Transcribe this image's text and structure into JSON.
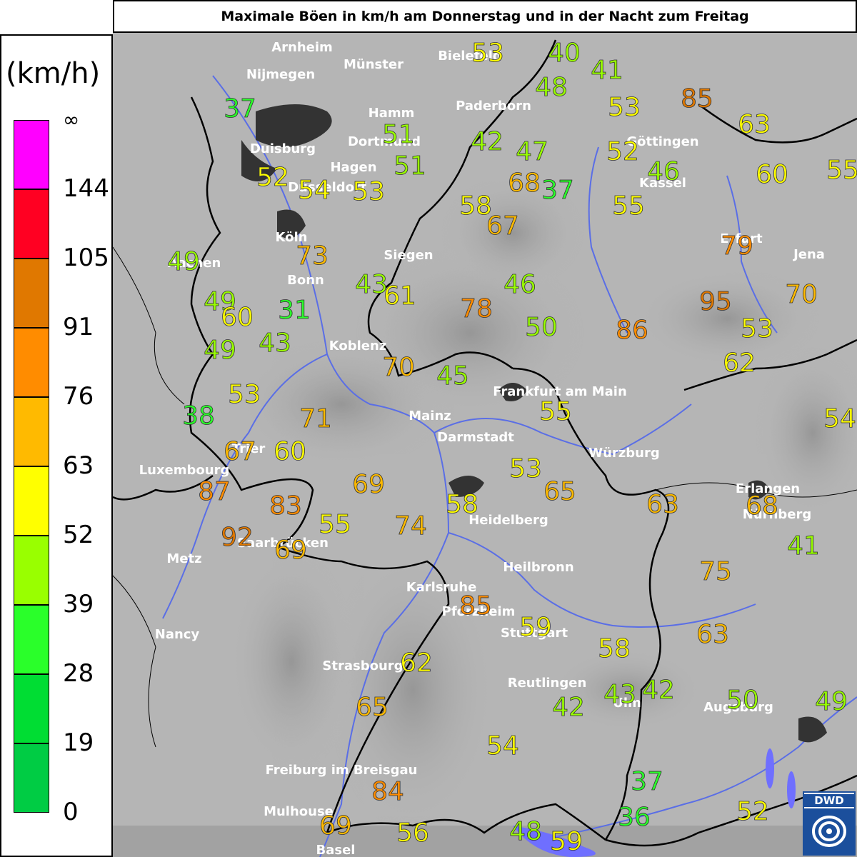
{
  "title": "Maximale Böen in km/h am Donnerstag und in der Nacht zum Freitag",
  "legend": {
    "unit": "(km/h)",
    "ticks": [
      "∞",
      "144",
      "105",
      "91",
      "76",
      "63",
      "52",
      "39",
      "28",
      "19",
      "0"
    ],
    "colors": [
      "#ff00ff",
      "#ff0022",
      "#e07800",
      "#ff8c00",
      "#ffba00",
      "#ffff00",
      "#99ff00",
      "#2aff2a",
      "#00dd33",
      "#00cc44"
    ]
  },
  "logo_text": "DWD",
  "cities": [
    {
      "name": "Arnheim"
    },
    {
      "name": "Nijmegen"
    },
    {
      "name": "Münster"
    },
    {
      "name": "Bielefeld"
    },
    {
      "name": "Hamm"
    },
    {
      "name": "Paderborn"
    },
    {
      "name": "Duisburg"
    },
    {
      "name": "Dortmund"
    },
    {
      "name": "Hagen"
    },
    {
      "name": "Göttingen"
    },
    {
      "name": "Düsseldorf"
    },
    {
      "name": "Kassel"
    },
    {
      "name": "Köln"
    },
    {
      "name": "Erfurt"
    },
    {
      "name": "Siegen"
    },
    {
      "name": "Aachen"
    },
    {
      "name": "Jena"
    },
    {
      "name": "Bonn"
    },
    {
      "name": "Koblenz"
    },
    {
      "name": "Frankfurt am Main"
    },
    {
      "name": "Mainz"
    },
    {
      "name": "Darmstadt"
    },
    {
      "name": "Trier"
    },
    {
      "name": "Würzburg"
    },
    {
      "name": "Luxembourg"
    },
    {
      "name": "Erlangen"
    },
    {
      "name": "Nürnberg"
    },
    {
      "name": "Heidelberg"
    },
    {
      "name": "Saarbrücken"
    },
    {
      "name": "Metz"
    },
    {
      "name": "Heilbronn"
    },
    {
      "name": "Karlsruhe"
    },
    {
      "name": "Pforzheim"
    },
    {
      "name": "Stuttgart"
    },
    {
      "name": "Nancy"
    },
    {
      "name": "Strasbourg"
    },
    {
      "name": "Reutlingen"
    },
    {
      "name": "Ulm"
    },
    {
      "name": "Augsburg"
    },
    {
      "name": "Freiburg im Breisgau"
    },
    {
      "name": "Mulhouse"
    },
    {
      "name": "Basel"
    }
  ],
  "gust_values": [
    {
      "value": "53",
      "color": "#ffff00"
    },
    {
      "value": "40",
      "color": "#99ff00"
    },
    {
      "value": "41",
      "color": "#99ff00"
    },
    {
      "value": "48",
      "color": "#99ff00"
    },
    {
      "value": "85",
      "color": "#e07800"
    },
    {
      "value": "37",
      "color": "#2aff2a"
    },
    {
      "value": "53",
      "color": "#ffff00"
    },
    {
      "value": "63",
      "color": "#ffff00"
    },
    {
      "value": "51",
      "color": "#99ff00"
    },
    {
      "value": "42",
      "color": "#99ff00"
    },
    {
      "value": "47",
      "color": "#99ff00"
    },
    {
      "value": "52",
      "color": "#ffff00"
    },
    {
      "value": "60",
      "color": "#ffff00"
    },
    {
      "value": "55",
      "color": "#ffff00"
    },
    {
      "value": "51",
      "color": "#99ff00"
    },
    {
      "value": "46",
      "color": "#99ff00"
    },
    {
      "value": "52",
      "color": "#ffff00"
    },
    {
      "value": "54",
      "color": "#ffff00"
    },
    {
      "value": "53",
      "color": "#ffff00"
    },
    {
      "value": "68",
      "color": "#ffba00"
    },
    {
      "value": "37",
      "color": "#2aff2a"
    },
    {
      "value": "55",
      "color": "#ffff00"
    },
    {
      "value": "58",
      "color": "#ffff00"
    },
    {
      "value": "67",
      "color": "#ffba00"
    },
    {
      "value": "79",
      "color": "#ff8c00"
    },
    {
      "value": "49",
      "color": "#99ff00"
    },
    {
      "value": "73",
      "color": "#ffba00"
    },
    {
      "value": "43",
      "color": "#99ff00"
    },
    {
      "value": "46",
      "color": "#99ff00"
    },
    {
      "value": "61",
      "color": "#ffff00"
    },
    {
      "value": "70",
      "color": "#ffba00"
    },
    {
      "value": "49",
      "color": "#99ff00"
    },
    {
      "value": "31",
      "color": "#2aff2a"
    },
    {
      "value": "95",
      "color": "#e07800"
    },
    {
      "value": "78",
      "color": "#ff8c00"
    },
    {
      "value": "60",
      "color": "#ffff00"
    },
    {
      "value": "50",
      "color": "#99ff00"
    },
    {
      "value": "86",
      "color": "#ff8c00"
    },
    {
      "value": "53",
      "color": "#ffff00"
    },
    {
      "value": "49",
      "color": "#99ff00"
    },
    {
      "value": "43",
      "color": "#99ff00"
    },
    {
      "value": "62",
      "color": "#ffff00"
    },
    {
      "value": "70",
      "color": "#ffba00"
    },
    {
      "value": "45",
      "color": "#99ff00"
    },
    {
      "value": "53",
      "color": "#ffff00"
    },
    {
      "value": "55",
      "color": "#ffff00"
    },
    {
      "value": "38",
      "color": "#2aff2a"
    },
    {
      "value": "71",
      "color": "#ffba00"
    },
    {
      "value": "54",
      "color": "#ffff00"
    },
    {
      "value": "67",
      "color": "#ffba00"
    },
    {
      "value": "60",
      "color": "#ffff00"
    },
    {
      "value": "53",
      "color": "#ffff00"
    },
    {
      "value": "65",
      "color": "#ffba00"
    },
    {
      "value": "87",
      "color": "#ff8c00"
    },
    {
      "value": "69",
      "color": "#ffba00"
    },
    {
      "value": "63",
      "color": "#ffba00"
    },
    {
      "value": "68",
      "color": "#ffba00"
    },
    {
      "value": "83",
      "color": "#ff8c00"
    },
    {
      "value": "58",
      "color": "#ffff00"
    },
    {
      "value": "55",
      "color": "#ffff00"
    },
    {
      "value": "74",
      "color": "#ffba00"
    },
    {
      "value": "92",
      "color": "#e07800"
    },
    {
      "value": "69",
      "color": "#ffba00"
    },
    {
      "value": "41",
      "color": "#99ff00"
    },
    {
      "value": "75",
      "color": "#ffba00"
    },
    {
      "value": "85",
      "color": "#ff8c00"
    },
    {
      "value": "59",
      "color": "#ffff00"
    },
    {
      "value": "63",
      "color": "#ffba00"
    },
    {
      "value": "58",
      "color": "#ffff00"
    },
    {
      "value": "62",
      "color": "#ffff00"
    },
    {
      "value": "43",
      "color": "#99ff00"
    },
    {
      "value": "42",
      "color": "#99ff00"
    },
    {
      "value": "42",
      "color": "#99ff00"
    },
    {
      "value": "65",
      "color": "#ffba00"
    },
    {
      "value": "50",
      "color": "#99ff00"
    },
    {
      "value": "49",
      "color": "#99ff00"
    },
    {
      "value": "54",
      "color": "#ffff00"
    },
    {
      "value": "37",
      "color": "#2aff2a"
    },
    {
      "value": "84",
      "color": "#ff8c00"
    },
    {
      "value": "52",
      "color": "#ffff00"
    },
    {
      "value": "36",
      "color": "#2aff2a"
    },
    {
      "value": "69",
      "color": "#ffba00"
    },
    {
      "value": "56",
      "color": "#ffff00"
    },
    {
      "value": "48",
      "color": "#99ff00"
    },
    {
      "value": "59",
      "color": "#ffff00"
    }
  ]
}
